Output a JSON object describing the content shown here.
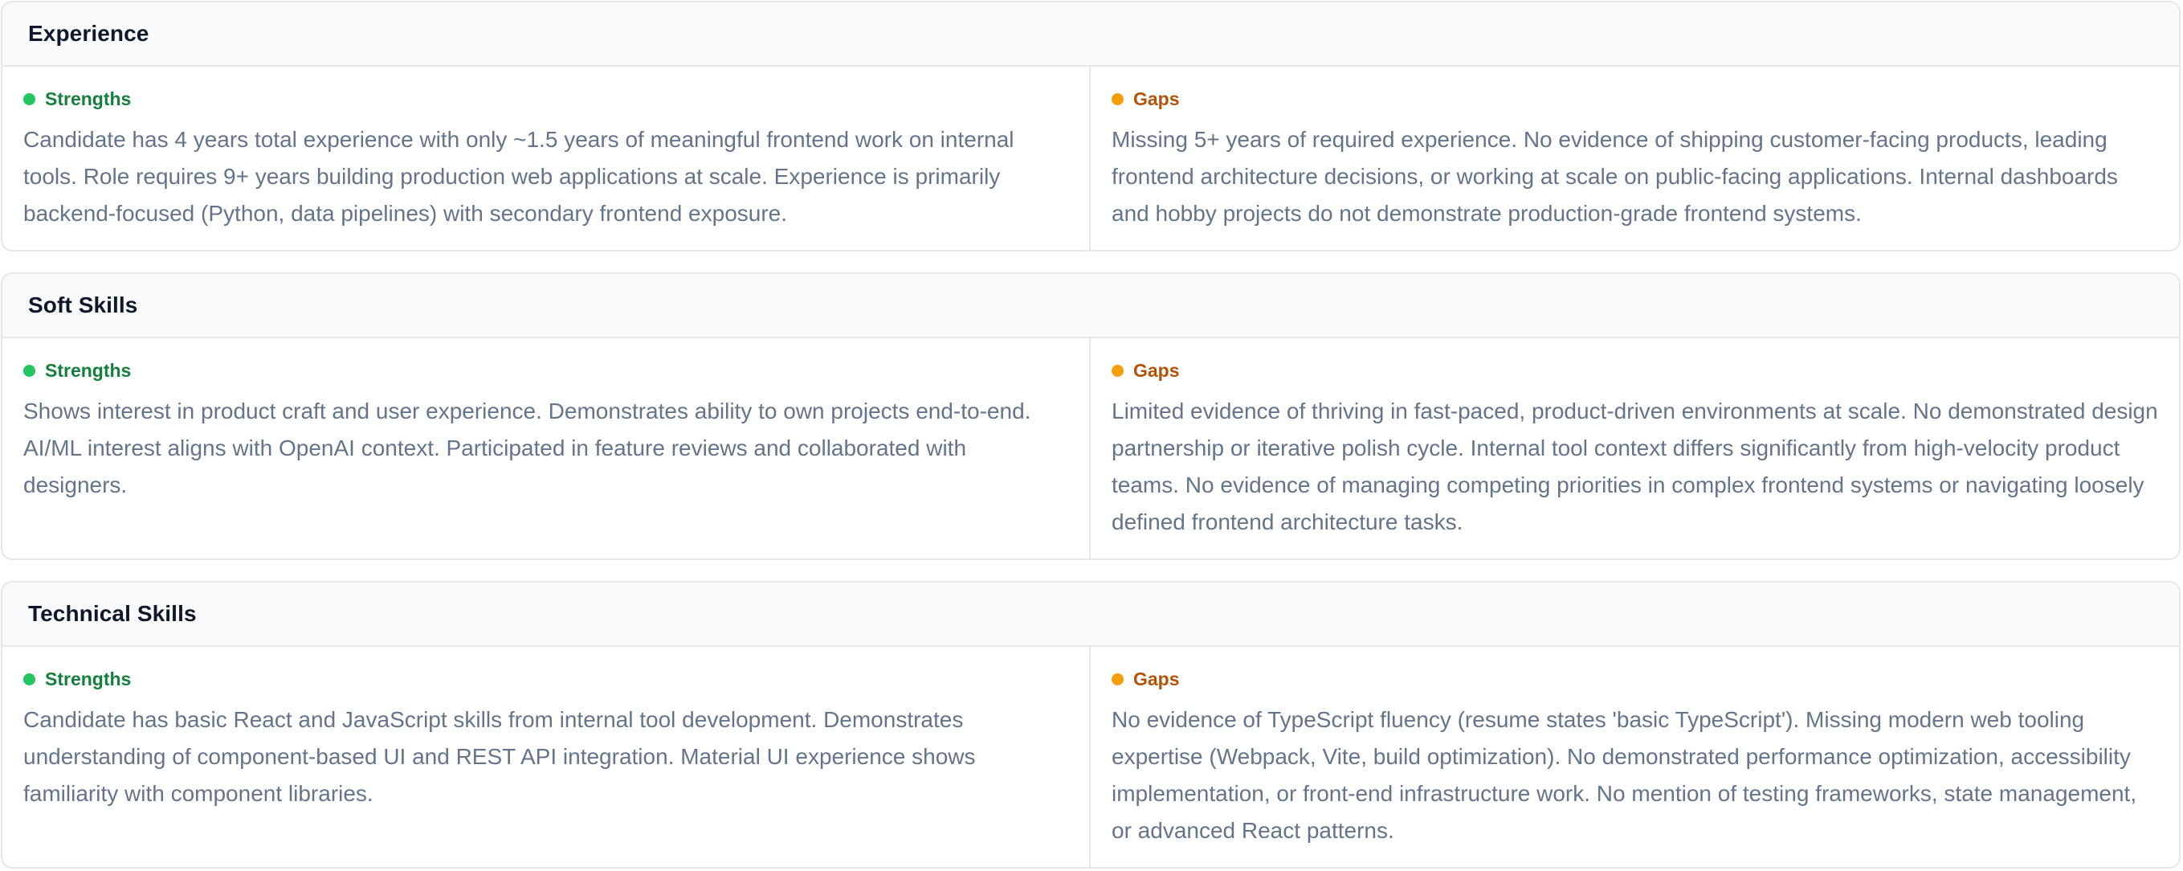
{
  "sections": [
    {
      "title": "Experience",
      "strengths_label": "Strengths",
      "strengths_text": "Candidate has 4 years total experience with only ~1.5 years of meaningful frontend work on internal tools. Role requires 9+ years building production web applications at scale. Experience is primarily backend-focused (Python, data pipelines) with secondary frontend exposure.",
      "gaps_label": "Gaps",
      "gaps_text": "Missing 5+ years of required experience. No evidence of shipping customer-facing products, leading frontend architecture decisions, or working at scale on public-facing applications. Internal dashboards and hobby projects do not demonstrate production-grade frontend systems."
    },
    {
      "title": "Soft Skills",
      "strengths_label": "Strengths",
      "strengths_text": "Shows interest in product craft and user experience. Demonstrates ability to own projects end-to-end. AI/ML interest aligns with OpenAI context. Participated in feature reviews and collaborated with designers.",
      "gaps_label": "Gaps",
      "gaps_text": "Limited evidence of thriving in fast-paced, product-driven environments at scale. No demonstrated design partnership or iterative polish cycle. Internal tool context differs significantly from high-velocity product teams. No evidence of managing competing priorities in complex frontend systems or navigating loosely defined frontend architecture tasks."
    },
    {
      "title": "Technical Skills",
      "strengths_label": "Strengths",
      "strengths_text": "Candidate has basic React and JavaScript skills from internal tool development. Demonstrates understanding of component-based UI and REST API integration. Material UI experience shows familiarity with component libraries.",
      "gaps_label": "Gaps",
      "gaps_text": "No evidence of TypeScript fluency (resume states 'basic TypeScript'). Missing modern web tooling expertise (Webpack, Vite, build optimization). No demonstrated performance optimization, accessibility implementation, or front-end infrastructure work. No mention of testing frameworks, state management, or advanced React patterns."
    }
  ],
  "colors": {
    "strength_dot": "#22c55e",
    "strength_label": "#15803d",
    "gap_dot": "#f59e0b",
    "gap_label": "#b45309",
    "body_text": "#64748b",
    "header_bg": "#f8fafc",
    "border": "#e5e7eb"
  }
}
